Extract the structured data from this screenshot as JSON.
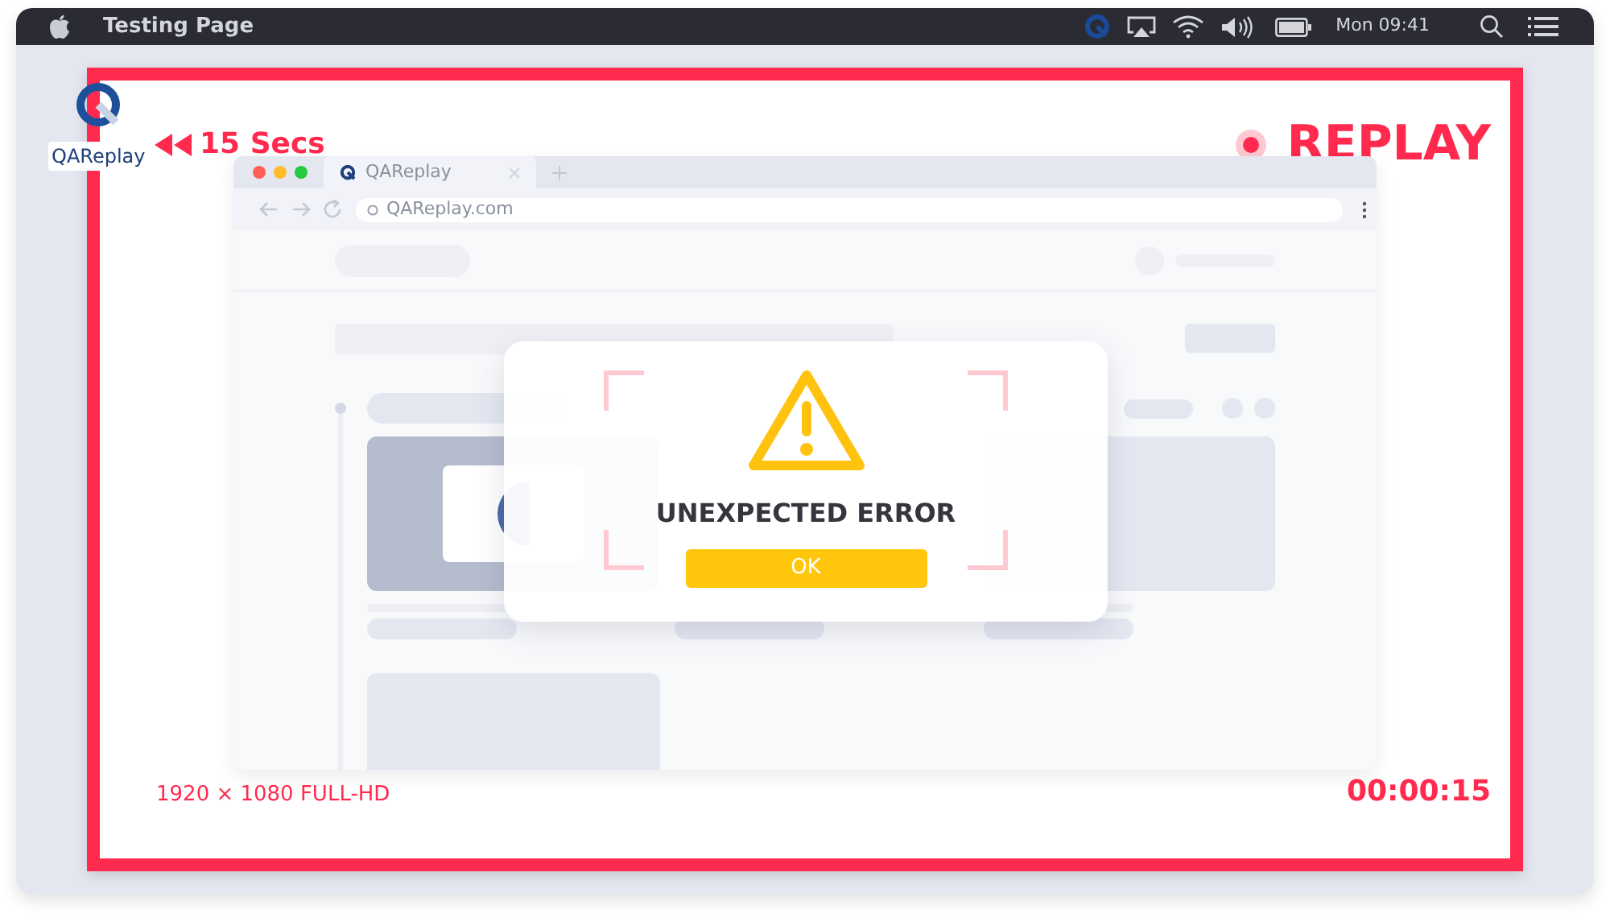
{
  "menu_bar": {
    "app_name": "Testing Page",
    "clock": "Mon 09:41"
  },
  "logo": {
    "text": "QAReplay"
  },
  "recording": {
    "rewind": "15 Secs",
    "badge": "REPLAY",
    "recording": true,
    "resolution": "1920 × 1080 FULL-HD",
    "timer": "00:00:15"
  },
  "browser": {
    "tabs": [
      {
        "title": "QAReplay",
        "selected": true
      }
    ],
    "url": "QAReplay.com"
  },
  "dialog": {
    "message": "UNEXPECTED ERROR",
    "button": "OK"
  }
}
